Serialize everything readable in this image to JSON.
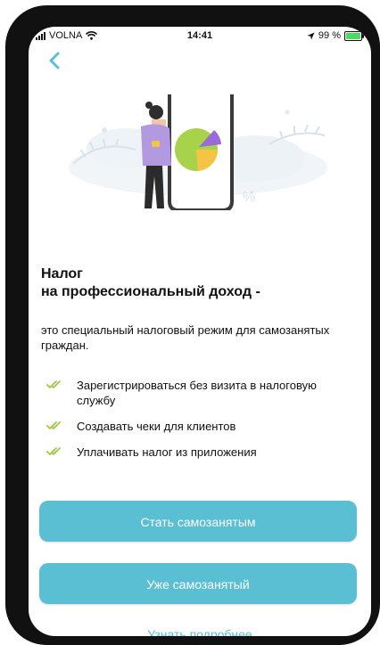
{
  "status_bar": {
    "carrier": "VOLNA",
    "time": "14:41",
    "battery": "99 %"
  },
  "header": {
    "back_icon": "chevron-left-icon"
  },
  "content": {
    "title_line1": "Налог",
    "title_line2": "на профессиональный доход -",
    "description": "это специальный налоговый режим для самозанятых граждан.",
    "features": [
      "Зарегистрироваться без визита в налоговую службу",
      "Создавать чеки для клиентов",
      "Уплачивать налог из приложения"
    ]
  },
  "actions": {
    "become_label": "Стать самозанятым",
    "already_label": "Уже самозанятый",
    "learn_more_label": "Узнать подробнее"
  },
  "colors": {
    "accent": "#5abfd3",
    "check": "#9cc93d"
  }
}
